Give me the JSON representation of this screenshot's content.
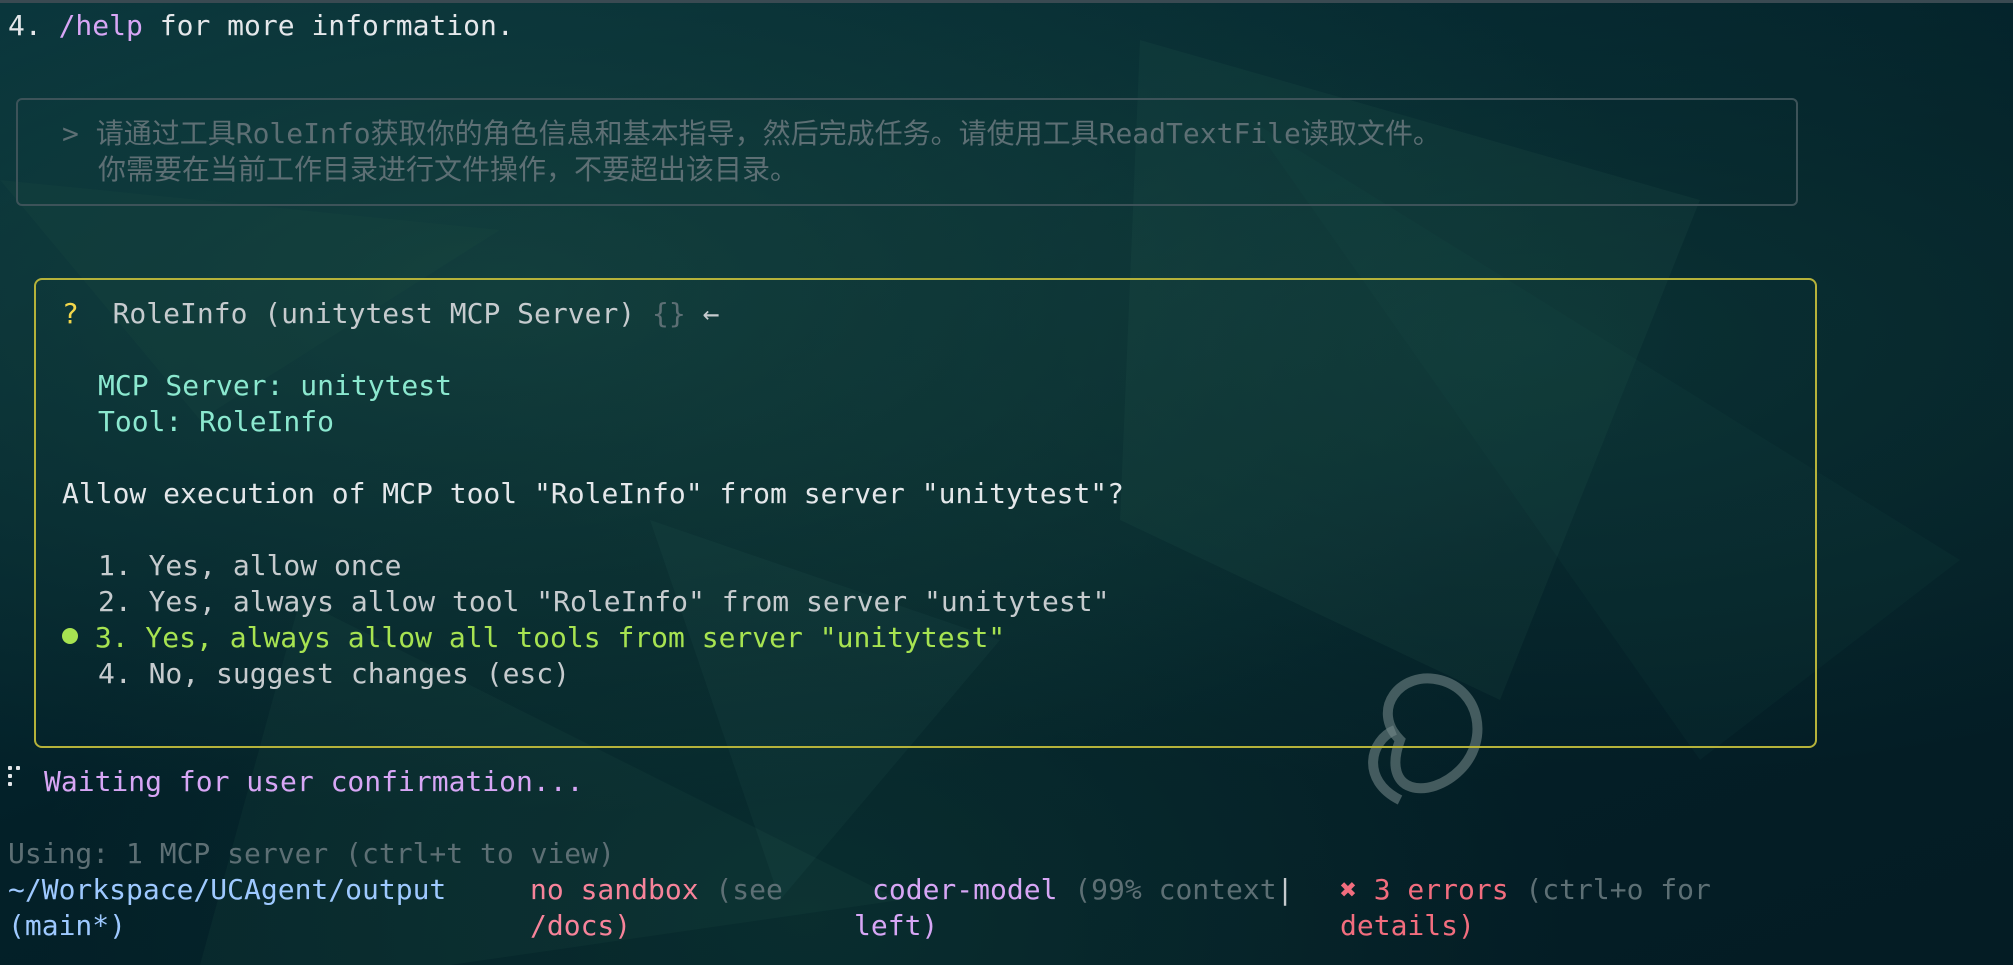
{
  "header": {
    "number": "4. ",
    "command": "/help",
    "rest": " for more information."
  },
  "prompt": {
    "marker": ">",
    "line1": "请通过工具RoleInfo获取你的角色信息和基本指导，然后完成任务。请使用工具ReadTextFile读取文件。",
    "line2": "你需要在当前工作目录进行文件操作，不要超出该目录。"
  },
  "confirm": {
    "question_mark": "?",
    "tool_title": "RoleInfo (unitytest MCP Server)",
    "args": "{}",
    "arrow": "←",
    "server_label": "MCP Server: unitytest",
    "tool_label": "Tool: RoleInfo",
    "question": "Allow execution of MCP tool \"RoleInfo\" from server \"unitytest\"?",
    "options": [
      "1. Yes, allow once",
      "2. Yes, always allow tool \"RoleInfo\" from server \"unitytest\"",
      "3. Yes, always allow all tools from server \"unitytest\"",
      "4. No, suggest changes (esc)"
    ],
    "selected_index": 2
  },
  "status": {
    "waiting": "Waiting for user confirmation...",
    "using": "Using: 1 MCP server (ctrl+t to view)"
  },
  "footer": {
    "path_line1": "~/Workspace/UCAgent/output",
    "path_line2": "(main*)",
    "sandbox": "no sandbox",
    "sandbox_hint1": " (see",
    "sandbox_hint2": "/docs)",
    "model": "coder-model",
    "context1": " (99% context",
    "separator": "|",
    "context2": "left)",
    "errors_icon": "✖",
    "errors": " 3 errors",
    "errors_hint1": " (ctrl+o for",
    "errors_hint2": "details)"
  },
  "colors": {
    "background": "#04232a",
    "accent_yellow": "#f2d64b",
    "selected_green": "#a7e351",
    "teal": "#8be8cf",
    "purple": "#d7a6f5",
    "error_red": "#f26d7e"
  }
}
